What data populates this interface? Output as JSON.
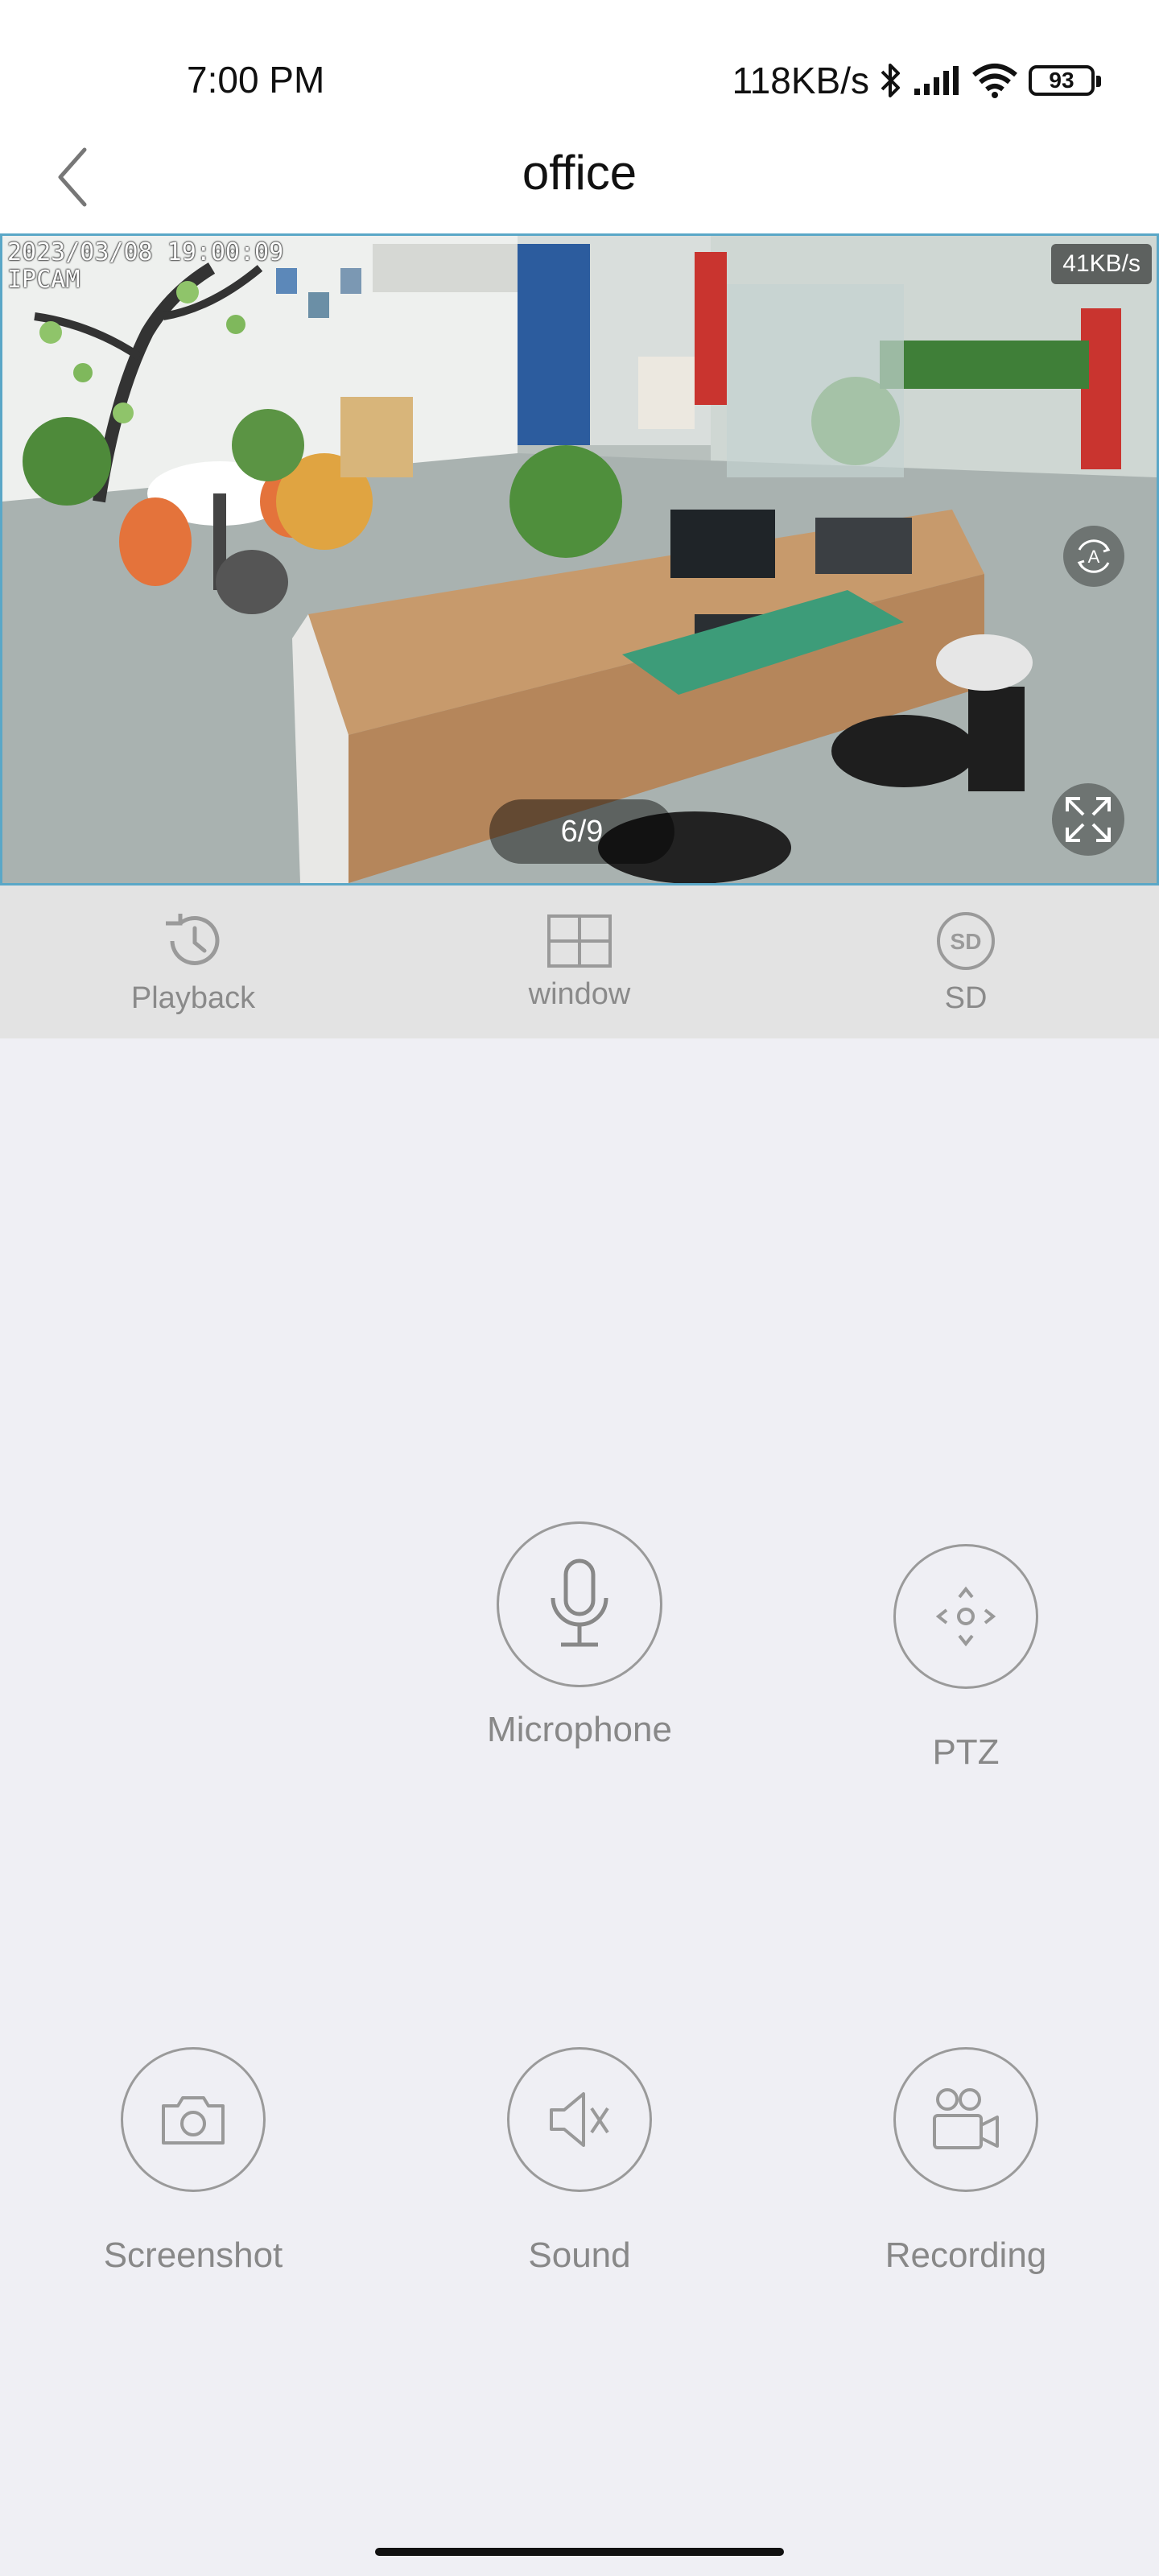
{
  "status_bar": {
    "time": "7:00 PM",
    "network_speed": "118KB/s",
    "battery": "93"
  },
  "header": {
    "title": "office",
    "back_icon": "chevron-left-icon"
  },
  "video": {
    "osd_datetime": "2023/03/08 19:00:09",
    "osd_name": "IPCAM",
    "bitrate": "41KB/s",
    "page_indicator": "6/9"
  },
  "tools": [
    {
      "label": "Playback",
      "icon": "history-icon"
    },
    {
      "label": "window",
      "icon": "grid-icon"
    },
    {
      "label": "SD",
      "icon": "sd-icon"
    }
  ],
  "controls": {
    "microphone": "Microphone",
    "ptz": "PTZ",
    "screenshot": "Screenshot",
    "sound": "Sound",
    "recording": "Recording"
  },
  "colors": {
    "background": "#efeff4",
    "tool_strip": "#e3e3e3",
    "icon_gray": "#9a9a9a",
    "video_border": "#5aa7c7"
  }
}
